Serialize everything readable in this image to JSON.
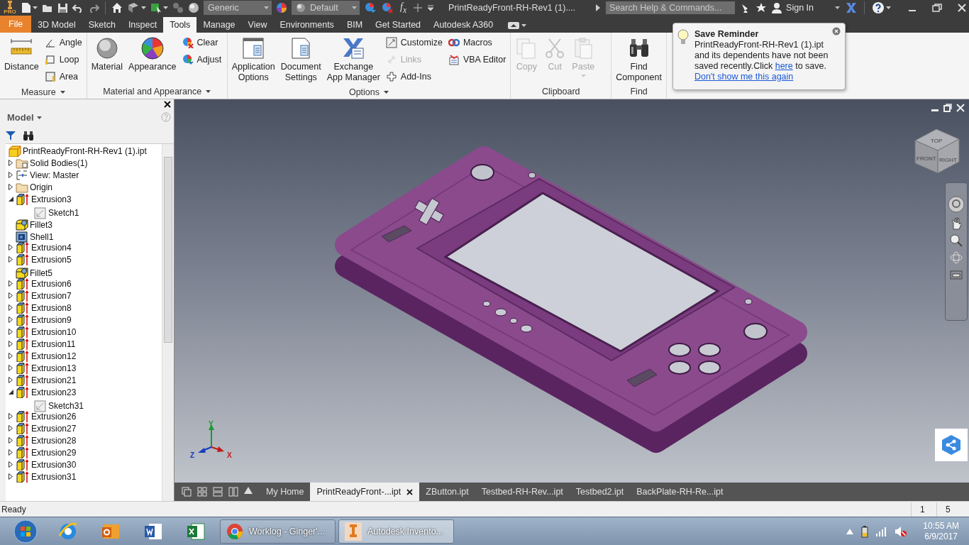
{
  "title_bar": {
    "logo_text": "PRO",
    "style_dropdown": "Generic",
    "appearance_dropdown": "Default",
    "function_label": "f$_{x}$",
    "document_title": "PrintReadyFront-RH-Rev1 (1)....",
    "search": {
      "placeholder": "Search Help & Commands..."
    },
    "sign_in": "Sign In"
  },
  "ribbon_tabs": [
    {
      "label": "File",
      "kind": "file",
      "selected": false
    },
    {
      "label": "3D Model",
      "kind": "tab",
      "selected": false
    },
    {
      "label": "Sketch",
      "kind": "tab",
      "selected": false
    },
    {
      "label": "Inspect",
      "kind": "tab",
      "selected": false
    },
    {
      "label": "Tools",
      "kind": "tab",
      "selected": true
    },
    {
      "label": "Manage",
      "kind": "tab",
      "selected": false
    },
    {
      "label": "View",
      "kind": "tab",
      "selected": false
    },
    {
      "label": "Environments",
      "kind": "tab",
      "selected": false
    },
    {
      "label": "BIM",
      "kind": "tab",
      "selected": false
    },
    {
      "label": "Get Started",
      "kind": "tab",
      "selected": false
    },
    {
      "label": "Autodesk A360",
      "kind": "tab",
      "selected": false
    }
  ],
  "ribbon_panels": [
    {
      "title": "Measure",
      "has_menu": true,
      "tools": [
        {
          "label": "Distance",
          "kind": "large",
          "disabled": false
        },
        {
          "label": "Angle",
          "kind": "small",
          "disabled": false
        },
        {
          "label": "Loop",
          "kind": "small",
          "disabled": false
        },
        {
          "label": "Area",
          "kind": "small",
          "disabled": false
        }
      ]
    },
    {
      "title": "Material and Appearance",
      "has_menu": true,
      "tools": [
        {
          "label": "Material",
          "kind": "large",
          "disabled": false
        },
        {
          "label": "Appearance",
          "kind": "large",
          "disabled": false
        },
        {
          "label": "Clear",
          "kind": "small",
          "disabled": false
        },
        {
          "label": "Adjust",
          "kind": "small",
          "disabled": false
        }
      ]
    },
    {
      "title": "Options",
      "has_menu": true,
      "tools": [
        {
          "label": "Application\nOptions",
          "kind": "large",
          "disabled": false
        },
        {
          "label": "Document\nSettings",
          "kind": "large",
          "disabled": false
        },
        {
          "label": "Exchange\nApp Manager",
          "kind": "large",
          "disabled": false
        },
        {
          "label": "Customize",
          "kind": "small",
          "disabled": false
        },
        {
          "label": "Links",
          "kind": "small",
          "disabled": true
        },
        {
          "label": "Add-Ins",
          "kind": "small",
          "disabled": false
        },
        {
          "label": "Macros",
          "kind": "small",
          "disabled": false
        },
        {
          "label": "VBA Editor",
          "kind": "small",
          "disabled": false
        }
      ]
    },
    {
      "title": "Clipboard",
      "has_menu": false,
      "tools": [
        {
          "label": "Copy",
          "kind": "large",
          "disabled": true
        },
        {
          "label": "Cut",
          "kind": "large",
          "disabled": true
        },
        {
          "label": "Paste",
          "kind": "large",
          "disabled": true
        }
      ]
    },
    {
      "title": "Find",
      "has_menu": false,
      "tools": [
        {
          "label": "Find\nComponent",
          "kind": "large",
          "disabled": false
        }
      ]
    }
  ],
  "save_reminder": {
    "title": "Save Reminder",
    "message": "PrintReadyFront-RH-Rev1 (1).ipt and its dependents have not been saved recently.Click ",
    "link": "here",
    "message_end": " to save.",
    "dismiss_link": "Don't show me this again"
  },
  "browser": {
    "title": "Model",
    "root": {
      "label": "PrintReadyFront-RH-Rev1 (1).ipt",
      "kind": "part"
    },
    "items": [
      {
        "label": "Solid Bodies(1)",
        "kind": "bodies",
        "expandable": true,
        "expanded": false
      },
      {
        "label": "View: Master",
        "kind": "view",
        "expandable": true,
        "expanded": false
      },
      {
        "label": "Origin",
        "kind": "folder",
        "expandable": true,
        "expanded": false
      },
      {
        "label": "Extrusion3",
        "kind": "extrusion",
        "expandable": true,
        "expanded": true,
        "children": [
          {
            "label": "Sketch1",
            "kind": "sketch",
            "expandable": false,
            "expanded": false
          }
        ]
      },
      {
        "label": "Fillet3",
        "kind": "fillet",
        "expandable": false,
        "expanded": false
      },
      {
        "label": "Shell1",
        "kind": "shell",
        "expandable": false,
        "expanded": false
      },
      {
        "label": "Extrusion4",
        "kind": "extrusion",
        "expandable": true,
        "expanded": false
      },
      {
        "label": "Extrusion5",
        "kind": "extrusion",
        "expandable": true,
        "expanded": false
      },
      {
        "label": "Fillet5",
        "kind": "fillet",
        "expandable": false,
        "expanded": false
      },
      {
        "label": "Extrusion6",
        "kind": "extrusion",
        "expandable": true,
        "expanded": false
      },
      {
        "label": "Extrusion7",
        "kind": "extrusion",
        "expandable": true,
        "expanded": false
      },
      {
        "label": "Extrusion8",
        "kind": "extrusion",
        "expandable": true,
        "expanded": false
      },
      {
        "label": "Extrusion9",
        "kind": "extrusion",
        "expandable": true,
        "expanded": false
      },
      {
        "label": "Extrusion10",
        "kind": "extrusion",
        "expandable": true,
        "expanded": false
      },
      {
        "label": "Extrusion11",
        "kind": "extrusion",
        "expandable": true,
        "expanded": false
      },
      {
        "label": "Extrusion12",
        "kind": "extrusion",
        "expandable": true,
        "expanded": false
      },
      {
        "label": "Extrusion13",
        "kind": "extrusion",
        "expandable": true,
        "expanded": false
      },
      {
        "label": "Extrusion21",
        "kind": "extrusion",
        "expandable": true,
        "expanded": false
      },
      {
        "label": "Extrusion23",
        "kind": "extrusion",
        "expandable": true,
        "expanded": true,
        "children": [
          {
            "label": "Sketch31",
            "kind": "sketch",
            "expandable": false,
            "expanded": false
          }
        ]
      },
      {
        "label": "Extrusion26",
        "kind": "extrusion",
        "expandable": true,
        "expanded": false
      },
      {
        "label": "Extrusion27",
        "kind": "extrusion",
        "expandable": true,
        "expanded": false
      },
      {
        "label": "Extrusion28",
        "kind": "extrusion",
        "expandable": true,
        "expanded": false
      },
      {
        "label": "Extrusion29",
        "kind": "extrusion",
        "expandable": true,
        "expanded": false
      },
      {
        "label": "Extrusion30",
        "kind": "extrusion",
        "expandable": true,
        "expanded": false
      },
      {
        "label": "Extrusion31",
        "kind": "extrusion",
        "expandable": true,
        "expanded": false
      }
    ]
  },
  "viewport": {
    "viewcube": {
      "top": "TOP",
      "front": "FRONT",
      "right": "RIGHT"
    },
    "axes": {
      "x": "X",
      "y": "Y",
      "z": "Z"
    }
  },
  "document_tabs": [
    {
      "label": "My Home",
      "selected": false
    },
    {
      "label": "PrintReadyFront-...ipt",
      "selected": true
    },
    {
      "label": "ZButton.ipt",
      "selected": false
    },
    {
      "label": "Testbed-RH-Rev...ipt",
      "selected": false
    },
    {
      "label": "Testbed2.ipt",
      "selected": false
    },
    {
      "label": "BackPlate-RH-Re...ipt",
      "selected": false
    }
  ],
  "status_bar": {
    "text": "Ready",
    "fields": [
      "1",
      "5"
    ]
  },
  "taskbar": {
    "apps": [
      {
        "label": "Worklog - Ginger'...",
        "kind": "chrome",
        "selected": false
      },
      {
        "label": "Autodesk Invento...",
        "kind": "inventor",
        "selected": true
      }
    ],
    "time": "10:55 AM",
    "date": "6/9/2017"
  }
}
